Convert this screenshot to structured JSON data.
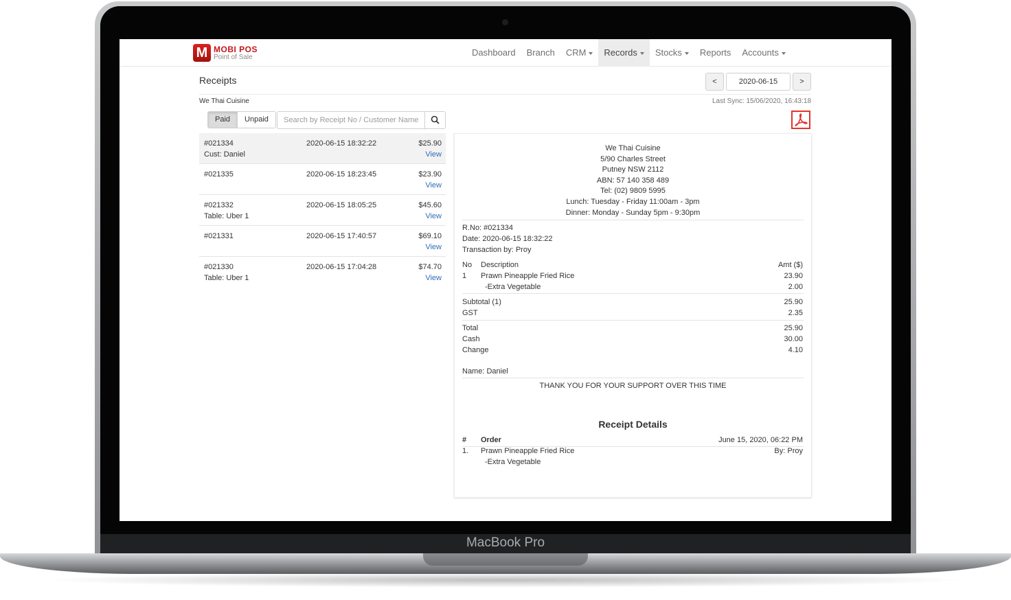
{
  "device": {
    "label": "MacBook Pro"
  },
  "brand": {
    "name": "MOBI POS",
    "tagline": "Point of Sale",
    "mark": "M"
  },
  "nav": {
    "dashboard": "Dashboard",
    "branch": "Branch",
    "crm": "CRM",
    "records": "Records",
    "stocks": "Stocks",
    "reports": "Reports",
    "accounts": "Accounts"
  },
  "page": {
    "title": "Receipts",
    "branch_name": "We Thai Cuisine",
    "last_sync": "Last Sync: 15/06/2020, 16:43:18",
    "date_prev": "<",
    "date_value": "2020-06-15",
    "date_next": ">"
  },
  "filter": {
    "paid": "Paid",
    "unpaid": "Unpaid",
    "search_placeholder": "Search by Receipt No / Customer Name"
  },
  "receipts": [
    {
      "no": "#021334",
      "sub": "Cust: Daniel",
      "datetime": "2020-06-15 18:32:22",
      "amount": "$25.90",
      "view": "View"
    },
    {
      "no": "#021335",
      "sub": "",
      "datetime": "2020-06-15 18:23:45",
      "amount": "$23.90",
      "view": "View"
    },
    {
      "no": "#021332",
      "sub": "Table: Uber 1",
      "datetime": "2020-06-15 18:05:25",
      "amount": "$45.60",
      "view": "View"
    },
    {
      "no": "#021331",
      "sub": "",
      "datetime": "2020-06-15 17:40:57",
      "amount": "$69.10",
      "view": "View"
    },
    {
      "no": "#021330",
      "sub": "Table: Uber 1",
      "datetime": "2020-06-15 17:04:28",
      "amount": "$74.70",
      "view": "View"
    }
  ],
  "receipt": {
    "header": {
      "name": "We Thai Cuisine",
      "address1": "5/90 Charles Street",
      "address2": "Putney NSW 2112",
      "abn": "ABN: 57 140 358 489",
      "tel": "Tel: (02) 9809 5995",
      "lunch": "Lunch: Tuesday - Friday 11:00am - 3pm",
      "dinner": "Dinner: Monday - Sunday 5pm - 9:30pm"
    },
    "rno": "R.No: #021334",
    "date": "Date: 2020-06-15 18:32:22",
    "transaction_by": "Transaction by: Proy",
    "col_no": "No",
    "col_desc": "Description",
    "col_amt": "Amt ($)",
    "item_no": "1",
    "item_desc": "Prawn Pineapple Fried Rice",
    "item_amt": "23.90",
    "mod_desc": "-Extra Vegetable",
    "mod_amt": "2.00",
    "subtotal_label": "Subtotal (1)",
    "subtotal": "25.90",
    "gst_label": "GST",
    "gst": "2.35",
    "total_label": "Total",
    "total": "25.90",
    "cash_label": "Cash",
    "cash": "30.00",
    "change_label": "Change",
    "change": "4.10",
    "name": "Name: Daniel",
    "thanks": "THANK YOU FOR YOUR SUPPORT OVER THIS TIME"
  },
  "details": {
    "title": "Receipt Details",
    "col_hash": "#",
    "col_order": "Order",
    "order_time": "June 15, 2020, 06:22 PM",
    "line_no": "1.",
    "line_item": "Prawn Pineapple Fried Rice",
    "line_by": "By: Proy",
    "line_mod": "-Extra Vegetable"
  },
  "colors": {
    "brand_red": "#c4161c",
    "link_blue": "#2a6fb5",
    "pdf_red": "#e0342c"
  },
  "icons": {
    "search": "search-icon",
    "pdf": "pdf-icon",
    "caret": "caret-down-icon"
  }
}
